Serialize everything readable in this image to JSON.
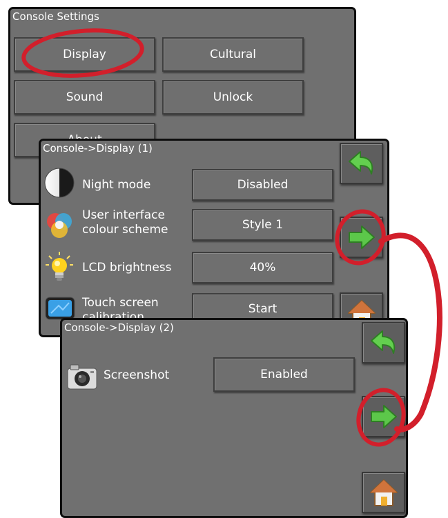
{
  "console_settings": {
    "title": "Console Settings",
    "buttons": {
      "display": "Display",
      "cultural": "Cultural",
      "sound": "Sound",
      "unlock": "Unlock",
      "about": "About"
    }
  },
  "display_page_1": {
    "title": "Console->Display (1)",
    "rows": [
      {
        "label": "Night mode",
        "value": "Disabled",
        "icon": "night-mode-icon"
      },
      {
        "label": "User interface\ncolour scheme",
        "value": "Style 1",
        "icon": "colour-scheme-icon"
      },
      {
        "label": "LCD brightness",
        "value": "40%",
        "icon": "lightbulb-icon"
      },
      {
        "label": "Touch screen\ncalibration",
        "value": "Start",
        "icon": "touchscreen-icon"
      }
    ]
  },
  "display_page_2": {
    "title": "Console->Display (2)",
    "rows": [
      {
        "label": "Screenshot",
        "value": "Enabled",
        "icon": "camera-icon"
      }
    ]
  },
  "colors": {
    "panel_bg": "#707070",
    "panel_border": "#0d0d0d",
    "button_bg": "#6f6f6f",
    "highlight_red": "#d21f2b",
    "arrow_green": "#5cc74a"
  }
}
